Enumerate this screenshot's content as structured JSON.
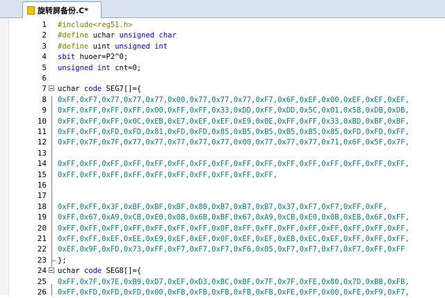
{
  "tab": {
    "label": "旋转屏备份.C*"
  },
  "lines": [
    {
      "n": "1",
      "seg": [
        [
          "pp",
          "#include<reg51.h>"
        ]
      ]
    },
    {
      "n": "2",
      "seg": [
        [
          "pp",
          "#define "
        ],
        [
          "tx",
          "uchar "
        ],
        [
          "kw",
          "unsigned char"
        ]
      ]
    },
    {
      "n": "3",
      "seg": [
        [
          "pp",
          "#define "
        ],
        [
          "tx",
          "uint "
        ],
        [
          "kw",
          "unsigned int"
        ]
      ]
    },
    {
      "n": "4",
      "seg": [
        [
          "kw",
          "sbit "
        ],
        [
          "tx",
          "huoer=P2^0;"
        ]
      ]
    },
    {
      "n": "5",
      "seg": [
        [
          "kw",
          "unsigned int "
        ],
        [
          "tx",
          "cnt=0;"
        ]
      ]
    },
    {
      "n": "6",
      "seg": []
    },
    {
      "n": "7",
      "fold": true,
      "seg": [
        [
          "tx",
          "uchar "
        ],
        [
          "kw",
          "code "
        ],
        [
          "tx",
          "SEG7[]={"
        ]
      ]
    },
    {
      "n": "8",
      "seg": [
        [
          "hex",
          "0xFF,0xF7,0x77,0x77,0x77,0x00,0x77,0x77,0x77,0xF7,0x6F,0xEF,0x00,0xEF,0xEF,0xEF,"
        ]
      ]
    },
    {
      "n": "9",
      "seg": [
        [
          "hex",
          "0xFF,0xFF,0xFF,0xFF,0x00,0xFF,0xFF,0x33,0xDD,0xFF,0xDD,0x5C,0x01,0x5B,0xDB,0xDB,"
        ]
      ]
    },
    {
      "n": "10",
      "seg": [
        [
          "hex",
          "0xFF,0xFF,0xFF,0x0C,0xEB,0xE7,0xEF,0xEF,0xE9,0x0E,0xFF,0xFF,0x33,0xBD,0xBF,0xBF,"
        ]
      ]
    },
    {
      "n": "11",
      "seg": [
        [
          "hex",
          "0xFF,0xFF,0xFD,0xFD,0x81,0xFD,0xFD,0x85,0xB5,0xB5,0xB5,0xB5,0x85,0xFD,0xFD,0xFF,"
        ]
      ]
    },
    {
      "n": "12",
      "seg": [
        [
          "hex",
          "0xFF,0x7F,0x7F,0x77,0x77,0x77,0x77,0x77,0x00,0x77,0x77,0x77,0x71,0x6F,0x5F,0x7F,"
        ]
      ]
    },
    {
      "n": "13",
      "seg": []
    },
    {
      "n": "14",
      "seg": [
        [
          "hex",
          "0xFF,0xFF,0xFF,0xFF,0xFF,0xFF,0xFF,0xFF,0xFF,0xFF,0xFF,0xFF,0xFF,0xFF,0xFF,0xFF,"
        ]
      ]
    },
    {
      "n": "15",
      "seg": [
        [
          "hex",
          "0xFF,0xFF,0xFF,0xFF,0xFF,0xFF,0xFF,0xFF,0xFF,0xFF,"
        ]
      ]
    },
    {
      "n": "16",
      "seg": []
    },
    {
      "n": "17",
      "seg": []
    },
    {
      "n": "18",
      "seg": [
        [
          "hex",
          "0xFF,0xFF,0x3F,0xBF,0xBF,0xBF,0x80,0xB7,0xB7,0xB7,0x37,0xF7,0xF7,0xFF,0xFF,"
        ]
      ]
    },
    {
      "n": "19",
      "seg": [
        [
          "hex",
          "0xFF,0x67,0xA9,0xCB,0xE0,0x0B,0x6B,0xBF,0x67,0xA9,0xCB,0xE0,0x0B,0xEB,0x6F,0xFF,"
        ]
      ]
    },
    {
      "n": "20",
      "seg": [
        [
          "hex",
          "0xFF,0xFF,0xFF,0xFF,0xFF,0xFF,0xFF,0x0F,0xFF,0xFF,0xFF,0xFF,0xFF,0xFF,0xFF,0xFF,"
        ]
      ]
    },
    {
      "n": "21",
      "seg": [
        [
          "hex",
          "0xFF,0xFF,0xEF,0xEE,0xE9,0xEF,0xEF,0x0F,0xEF,0xEF,0xEB,0xEC,0xEF,0xFF,0xFF,0xFF,"
        ]
      ]
    },
    {
      "n": "22",
      "seg": [
        [
          "hex",
          "0xEF,0x9F,0xFD,0x73,0xFF,0xF7,0xF7,0xF7,0xF6,0x05,0xF7,0xF7,0xF7,0xF7,0xFF,0xFF"
        ]
      ]
    },
    {
      "n": "23",
      "end": true,
      "seg": [
        [
          "tx",
          "};"
        ]
      ]
    },
    {
      "n": "24",
      "fold": true,
      "seg": [
        [
          "tx",
          "uchar "
        ],
        [
          "kw",
          "code "
        ],
        [
          "tx",
          "SEG8[]={"
        ]
      ]
    },
    {
      "n": "25",
      "seg": [
        [
          "hex",
          "0xFF,0x7F,0x7E,0xB9,0xD7,0xEF,0xD3,0xBC,0xBF,0x7F,0x7F,0xFE,0x80,0x7D,0xBB,0xFB,"
        ]
      ]
    },
    {
      "n": "26",
      "seg": [
        [
          "hex",
          "0xFF,0xFD,0xFD,0xFD,0x00,0xFB,0xFB,0xFB,0xFB,0xFB,0xFE,0xFF,0x00,0xFE,0xF9,0xF7,"
        ]
      ]
    }
  ]
}
